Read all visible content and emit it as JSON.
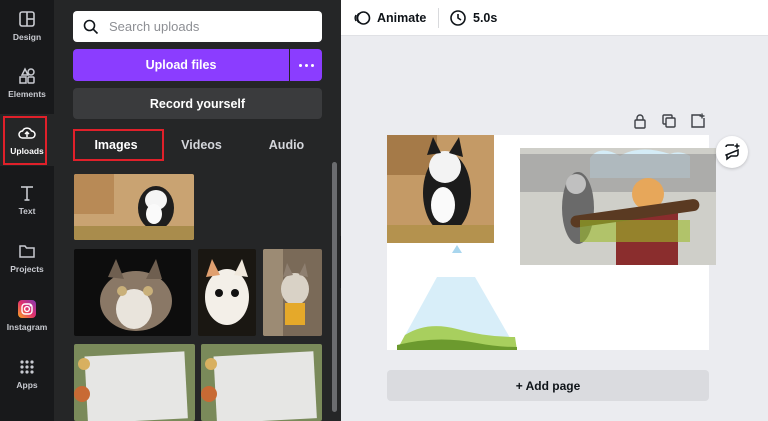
{
  "rail": {
    "items": [
      {
        "label": "Design",
        "icon": "design-icon"
      },
      {
        "label": "Elements",
        "icon": "elements-icon"
      },
      {
        "label": "Uploads",
        "icon": "upload-cloud-icon"
      },
      {
        "label": "Text",
        "icon": "text-icon"
      },
      {
        "label": "Projects",
        "icon": "folder-icon"
      },
      {
        "label": "Instagram",
        "icon": "instagram-icon"
      },
      {
        "label": "Apps",
        "icon": "apps-grid-icon"
      }
    ]
  },
  "panel": {
    "search_placeholder": "Search uploads",
    "upload_label": "Upload files",
    "record_label": "Record yourself",
    "tabs": [
      "Images",
      "Videos",
      "Audio"
    ]
  },
  "topbar": {
    "animate_label": "Animate",
    "duration_label": "5.0s"
  },
  "canvas": {
    "add_page_label": "+ Add page"
  },
  "colors": {
    "accent": "#8b3dff",
    "highlight": "#e0202a",
    "rail_bg": "#18191b",
    "panel_bg": "#252627"
  }
}
